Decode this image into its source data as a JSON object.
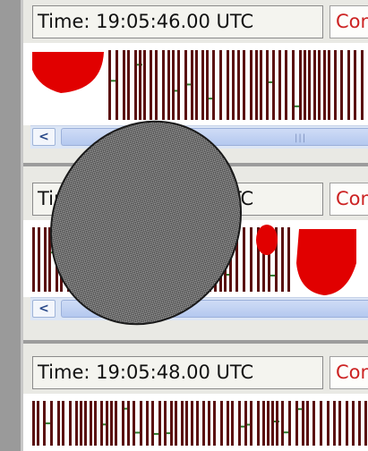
{
  "panels": [
    {
      "time": "Time: 19:05:46.00 UTC",
      "cond": "Conc"
    },
    {
      "time": "Time: 19:05:47.00 UTC",
      "cond": "Conc"
    },
    {
      "time": "Time: 19:05:48.00 UTC",
      "cond": "Conc"
    }
  ],
  "scrollbar": {
    "left_arrow": "<",
    "grip": "|||"
  },
  "icons": {
    "scroll_left": "chevron-left-icon"
  },
  "colors": {
    "bars": "#5a1010",
    "marks": "#2d7a2d",
    "blob": "#e10000",
    "scroll_bg": "#dce6f6",
    "cond_text": "#cc2222"
  }
}
